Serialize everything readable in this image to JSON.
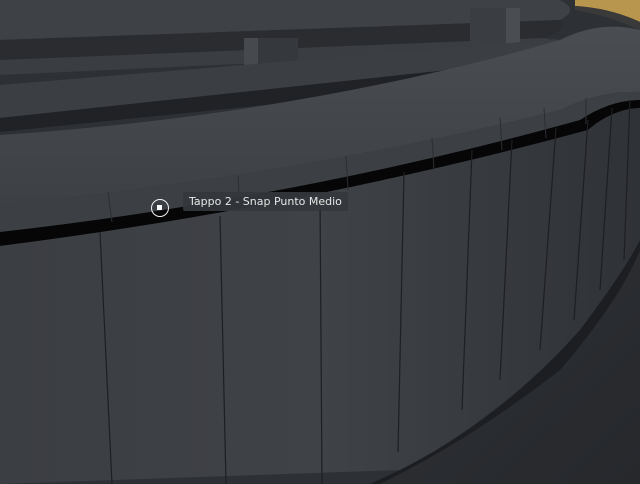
{
  "viewport": {
    "name": "3D modeling viewport",
    "colors": {
      "background": "#2b2e33",
      "surface": "#3a3d42",
      "surface_light": "#474a4f",
      "edge": "#1a1c1f",
      "highlight_accent": "#c9a45a"
    }
  },
  "snap": {
    "tooltip_text": "Tappo 2 - Snap Punto Medio",
    "marker_icon": "snap-midpoint-icon"
  }
}
